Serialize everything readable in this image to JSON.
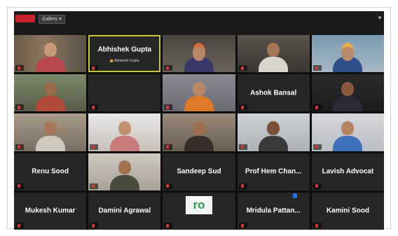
{
  "app": {
    "top_bar": {
      "rec_label": "",
      "view_label": "Gallery ▾"
    }
  },
  "tiles": [
    {
      "display_name": "",
      "tag": "",
      "video": true,
      "scene": "woman-shelves"
    },
    {
      "display_name": "Abhishek Gupta",
      "tag": "",
      "sub_tag": "Abhishek Gupta",
      "video": false,
      "speaking": true
    },
    {
      "display_name": "",
      "tag": "",
      "video": true,
      "scene": "man-turban"
    },
    {
      "display_name": "",
      "tag": "",
      "video": true,
      "scene": "man-room"
    },
    {
      "display_name": "",
      "tag": "",
      "video": true,
      "scene": "man-turban-blue"
    },
    {
      "display_name": "",
      "tag": "",
      "video": true,
      "scene": "man-mustache"
    },
    {
      "display_name": "",
      "tag": "",
      "video": false
    },
    {
      "display_name": "",
      "tag": "",
      "video": true,
      "scene": "woman-orange"
    },
    {
      "display_name": "Ashok Bansal",
      "tag": "",
      "video": false
    },
    {
      "display_name": "",
      "tag": "",
      "video": true,
      "scene": "man-dark"
    },
    {
      "display_name": "",
      "tag": "",
      "video": true,
      "scene": "man-room-2"
    },
    {
      "display_name": "",
      "tag": "",
      "video": true,
      "scene": "bright-window"
    },
    {
      "display_name": "",
      "tag": "",
      "video": true,
      "scene": "woman-wall"
    },
    {
      "display_name": "",
      "tag": "",
      "video": true,
      "scene": "woman-headset"
    },
    {
      "display_name": "",
      "tag": "",
      "video": true,
      "scene": "man-blue"
    },
    {
      "display_name": "Renu Sood",
      "tag": "",
      "video": false
    },
    {
      "display_name": "",
      "tag": "",
      "video": true,
      "scene": "man-framed"
    },
    {
      "display_name": "Sandeep Sud",
      "tag": "",
      "video": false
    },
    {
      "display_name": "Prof Hem Chan...",
      "tag": "",
      "video": false
    },
    {
      "display_name": "Lavish Advocat",
      "tag": "",
      "video": false
    },
    {
      "display_name": "Mukesh Kumar",
      "tag": "",
      "video": false
    },
    {
      "display_name": "Damini Agrawal",
      "tag": "",
      "video": false
    },
    {
      "display_name": "",
      "tag": "",
      "video": false,
      "logo": "ro"
    },
    {
      "display_name": "Mridula Pattan...",
      "tag": "",
      "video": false,
      "badge": ""
    },
    {
      "display_name": "Kamini Sood",
      "tag": "",
      "video": false
    }
  ],
  "colors": {
    "screen_bg": "#1a1a1a",
    "tile_bg": "#262626",
    "speaking_border": "#c9c43a",
    "rec_red": "#c8232b",
    "mute_red": "#d23a3a",
    "logo_green": "#2a9d4a"
  },
  "icons": [
    "record-icon",
    "mic-off-icon",
    "hand-icon",
    "more-dots-icon"
  ]
}
